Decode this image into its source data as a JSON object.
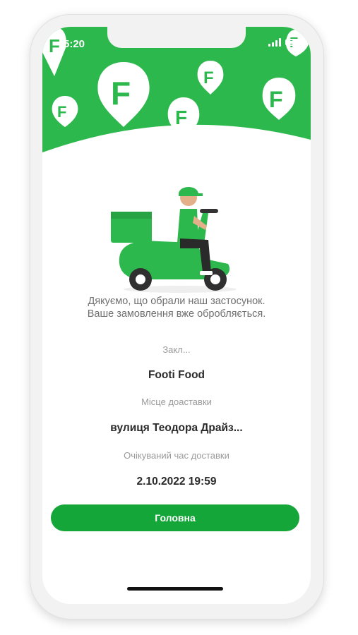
{
  "status_bar": {
    "time": "5:20"
  },
  "colors": {
    "brand": "#2db84d",
    "button": "#15a63a",
    "background": "#ffffff"
  },
  "icons": [
    "f-logo-pin-icon",
    "signal-icon",
    "battery-icon",
    "delivery-scooter-illustration"
  ],
  "message": {
    "line1": "Дякуємо, що обрали наш застосунок.",
    "line2": "Ваше замовлення вже обробляється."
  },
  "order": {
    "restaurant_label": "Закл...",
    "restaurant": "Footi Food",
    "address_label": "Місце доаставки",
    "address": "вулиця Теодора Драйз...",
    "time_label": "Очікуваний час доставки",
    "time": "2.10.2022 19:59"
  },
  "home_button": {
    "label": "Головна"
  }
}
